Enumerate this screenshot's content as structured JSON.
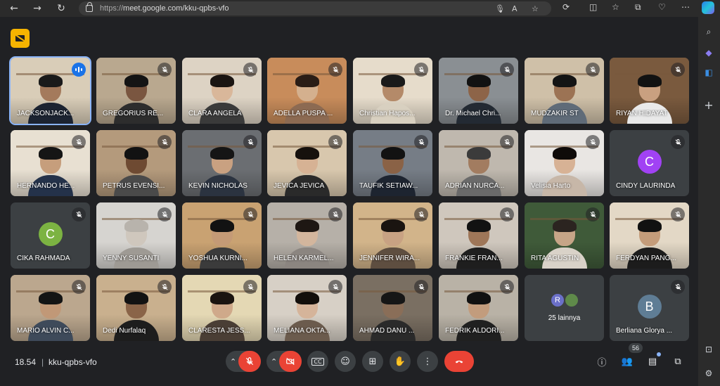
{
  "browser": {
    "url_proto": "https://",
    "url_host": "meet.google.com/kku-qpbs-vfo"
  },
  "meeting": {
    "time": "18.54",
    "separator": "|",
    "code": "kku-qpbs-vfo",
    "participant_count": "56"
  },
  "tiles": [
    {
      "name": "JACKSONJACK...",
      "kind": "video",
      "bg": "#d9cdb8",
      "skin": "#a47a5c",
      "hair": "#1a1a1a",
      "shirt": "#1c2331",
      "speaking": true,
      "active": true
    },
    {
      "name": "GREGORIUS RE...",
      "kind": "video",
      "bg": "#b9a88f",
      "skin": "#7a5640",
      "hair": "#141414",
      "shirt": "#2d2d2d"
    },
    {
      "name": "CLARA ANGELA",
      "kind": "video",
      "bg": "#ddd3c4",
      "skin": "#d9b79a",
      "hair": "#1b1512",
      "shirt": "#3a3a3a"
    },
    {
      "name": "ADELLA PUSPA ...",
      "kind": "video",
      "bg": "#c88c5b",
      "skin": "#d4b08e",
      "hair": "#2a1d16",
      "shirt": "#8c6a52"
    },
    {
      "name": "Christian Hapos...",
      "kind": "video",
      "bg": "#e6dccb",
      "skin": "#b48a69",
      "hair": "#1a1a1a",
      "shirt": "#d8d0c0"
    },
    {
      "name": "Dr. Michael Chri...",
      "kind": "video",
      "bg": "#8a8f93",
      "skin": "#8d6448",
      "hair": "#121212",
      "shirt": "#232a33"
    },
    {
      "name": "MUDZAKIR ST",
      "kind": "video",
      "bg": "#cfc0a8",
      "skin": "#9c7354",
      "hair": "#141414",
      "shirt": "#5f6b78"
    },
    {
      "name": "RIYAN HIDAYAT",
      "kind": "video",
      "bg": "#7a5a3e",
      "skin": "#c9a080",
      "hair": "#121212",
      "shirt": "#e9e9e9"
    },
    {
      "name": "HERNANDO HE...",
      "kind": "video",
      "bg": "#e8e0d2",
      "skin": "#c69e7c",
      "hair": "#151515",
      "shirt": "#24324a"
    },
    {
      "name": "PETRUS EVENSI...",
      "kind": "video",
      "bg": "#b49a7c",
      "skin": "#6e4a32",
      "hair": "#121212",
      "shirt": "#4a4a4a"
    },
    {
      "name": "KEVIN NICHOLAS",
      "kind": "video",
      "bg": "#6b6e72",
      "skin": "#c9a181",
      "hair": "#151515",
      "shirt": "#2b3340"
    },
    {
      "name": "JEVICA JEVICA",
      "kind": "video",
      "bg": "#d8c7ad",
      "skin": "#d6b294",
      "hair": "#16110d",
      "shirt": "#2a2a2a"
    },
    {
      "name": "TAUFIK SETIAW...",
      "kind": "video",
      "bg": "#767d86",
      "skin": "#8a6246",
      "hair": "#121212",
      "shirt": "#1d2430"
    },
    {
      "name": "ADRIAN NURCA...",
      "kind": "video",
      "bg": "#bfb8ae",
      "skin": "#a27c60",
      "hair": "#3b3b3b",
      "shirt": "#6a6a6a"
    },
    {
      "name": "Velisia Harto",
      "kind": "video",
      "bg": "#e9e6e3",
      "skin": "#d7b295",
      "hair": "#0f0b09",
      "shirt": "#c7b7a8"
    },
    {
      "name": "CINDY LAURINDA",
      "kind": "avatar",
      "letter": "C",
      "color": "#a142f4"
    },
    {
      "name": "CIKA RAHMADA",
      "kind": "avatar",
      "letter": "C",
      "color": "#7cb342"
    },
    {
      "name": "YENNY SUSANTI",
      "kind": "video",
      "bg": "#d6d4d0",
      "skin": "#cfc7bd",
      "hair": "#b8b3ac",
      "shirt": "#9e9a94"
    },
    {
      "name": "YOSHUA KURNI...",
      "kind": "video",
      "bg": "#c9a272",
      "skin": "#c49a76",
      "hair": "#121212",
      "shirt": "#3b3b3b"
    },
    {
      "name": "HELEN KARMEL...",
      "kind": "video",
      "bg": "#b6b0a8",
      "skin": "#d3b69d",
      "hair": "#1e1713",
      "shirt": "#8b8580"
    },
    {
      "name": "JENNIFER WIRA...",
      "kind": "video",
      "bg": "#d2b48a",
      "skin": "#c8a283",
      "hair": "#1a1410",
      "shirt": "#5e4e40"
    },
    {
      "name": "FRANKIE FRAN...",
      "kind": "video",
      "bg": "#cfc7bd",
      "skin": "#9e7658",
      "hair": "#121212",
      "shirt": "#1e1e1e"
    },
    {
      "name": "RITA AGUSTIN",
      "kind": "video",
      "bg": "#3f5a39",
      "skin": "#c6a587",
      "hair": "#2b2420",
      "shirt": "#d9d2c8"
    },
    {
      "name": "FERDYAN PANG...",
      "kind": "video",
      "bg": "#e3d8c6",
      "skin": "#c49c7a",
      "hair": "#111111",
      "shirt": "#1c1c1c"
    },
    {
      "name": "MARIO ALVIN C...",
      "kind": "video",
      "bg": "#bba78e",
      "skin": "#c19877",
      "hair": "#141414",
      "shirt": "#3e4a5a"
    },
    {
      "name": "Dedi Nurfalaq",
      "kind": "video",
      "bg": "#c9b08e",
      "skin": "#8a6448",
      "hair": "#121212",
      "shirt": "#1d1d1d"
    },
    {
      "name": "CLARESTA JESS...",
      "kind": "video",
      "bg": "#e4d8b4",
      "skin": "#cfa98a",
      "hair": "#1b1410",
      "shirt": "#4a3e35"
    },
    {
      "name": "MELIANA OKTA...",
      "kind": "video",
      "bg": "#d7d0c6",
      "skin": "#d5b49a",
      "hair": "#120e0b",
      "shirt": "#6b5b4d"
    },
    {
      "name": "AHMAD DANU ...",
      "kind": "video",
      "bg": "#7a6f62",
      "skin": "#8a6e58",
      "hair": "#161616",
      "shirt": "#2a2a2a"
    },
    {
      "name": "FEDRIK ALDORI...",
      "kind": "video",
      "bg": "#b9b2a6",
      "skin": "#c29c7d",
      "hair": "#111111",
      "shirt": "#202020"
    },
    {
      "name": "25 lainnya",
      "kind": "more"
    },
    {
      "name": "Berliana Glorya ...",
      "kind": "avatar",
      "letter": "B",
      "color": "#5f7d95"
    }
  ],
  "more_avatars": [
    {
      "letter": "R",
      "color": "#6b70c9"
    },
    {
      "letter": "",
      "color": "#5f8a4a"
    }
  ],
  "controls": {
    "mic": "mic-off",
    "camera": "camera-off",
    "captions_label": "CC",
    "reaction": "emoji",
    "present": "present-screen",
    "raise_hand": "hand",
    "more": "more-vertical",
    "leave": "leave-call"
  }
}
